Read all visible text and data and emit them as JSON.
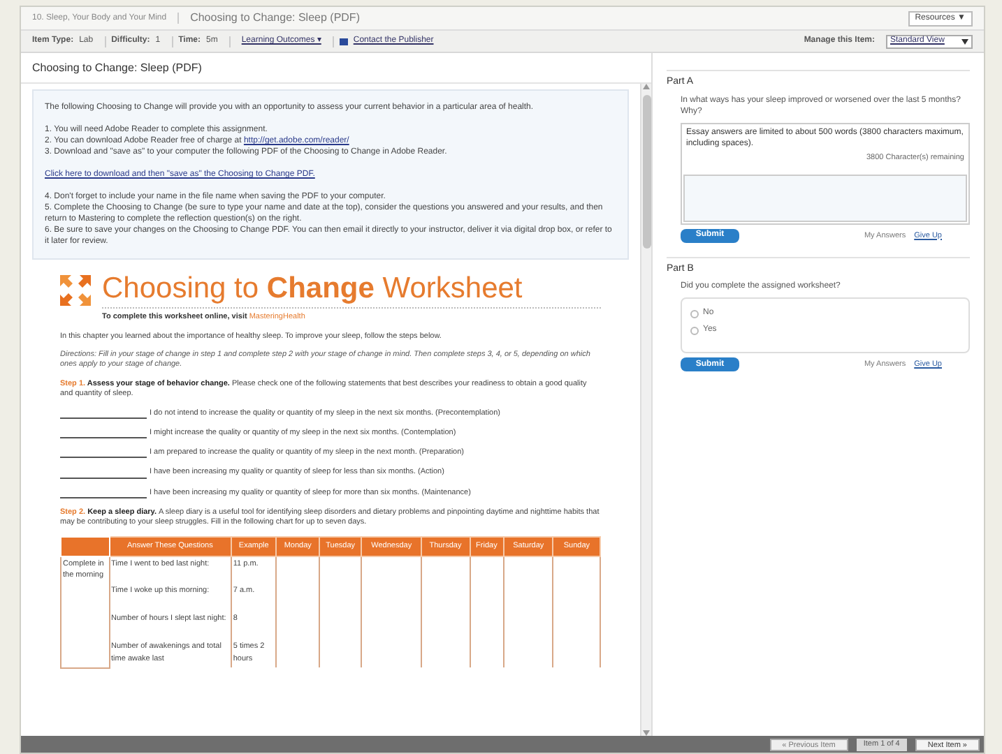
{
  "breadcrumb": {
    "course": "10. Sleep, Your Body and Your Mind",
    "item": "Choosing to Change: Sleep (PDF)",
    "resources": "Resources ▼"
  },
  "info_bar": {
    "fields": [
      {
        "label": "Item Type:",
        "value": "Lab"
      },
      {
        "label": "Difficulty:",
        "value": "1"
      },
      {
        "label": "Time:",
        "value": "5m"
      }
    ],
    "learning_outcomes": "Learning Outcomes ▾",
    "contact": "Contact the Publisher",
    "manage_label": "Manage this Item:",
    "manage_view": "Standard View"
  },
  "content": {
    "title": "Choosing to Change: Sleep (PDF)",
    "intro": "The following Choosing to Change will provide you with an opportunity to assess your current behavior in a particular area of health.",
    "steps_a": [
      {
        "text": "1. You will need Adobe Reader to complete this assignment."
      },
      {
        "text": "2. You can download Adobe Reader free of charge at ",
        "link": "http://get.adobe.com/reader/"
      },
      {
        "text": "3. Download and \"save as\" to your computer the following PDF of the Choosing to Change in Adobe Reader."
      }
    ],
    "download_link": "Click here to download and then \"save as\" the Choosing to Change PDF.",
    "steps_b": [
      "4. Don't forget to include your name in the file name when saving the PDF to your computer.",
      "5. Complete the Choosing to Change (be sure to type your name and date at the top), consider the questions you answered and your results, and then return to Mastering to complete the reflection question(s) on the right.",
      "6. Be sure to save your changes on the Choosing to Change PDF. You can then email it directly to your instructor, deliver it via digital drop box, or refer to it later for review."
    ]
  },
  "worksheet": {
    "title": "Choosing to **Change** Worksheet",
    "subtitle": "To complete this worksheet online, visit",
    "subtitle_link": "MasteringHealth",
    "intro": "In this chapter you learned about the importance of healthy sleep. To improve your sleep, follow the steps below.",
    "directions": "Directions: Fill in your stage of change in step 1 and complete step 2 with your stage of change in mind. Then complete steps 3, 4, or 5, depending on which ones apply to your stage of change.",
    "step1": {
      "label": "Step 1.",
      "heading": "Assess your stage of behavior change.",
      "text": "Please check one of the following statements that best describes your readiness to obtain a good quality and quantity of sleep."
    },
    "statements": [
      "I do not intend to increase the quality or quantity of my sleep in the next six months. (Precontemplation)",
      "I might increase the quality or quantity of my sleep in the next six months. (Contemplation)",
      "I am prepared to increase the quality or quantity of my sleep in the next month. (Preparation)",
      "I have been increasing my quality or quantity of sleep for less than six months. (Action)",
      "I have been increasing my quality or quantity of sleep for more than six months. (Maintenance)"
    ],
    "step2": {
      "label": "Step 2.",
      "heading": "Keep a sleep diary.",
      "text": "A sleep diary is a useful tool for identifying sleep disorders and dietary problems and pinpointing daytime and nighttime habits that may be contributing to your sleep struggles. Fill in the following chart for up to seven days."
    },
    "table": {
      "columns": [
        "Answer These Questions",
        "Example",
        "Monday",
        "Tuesday",
        "Wednesday",
        "Thursday",
        "Friday",
        "Saturday",
        "Sunday"
      ],
      "group": "Complete in the morning",
      "rows": [
        {
          "question": "Time I went to bed last night:",
          "example": "11 p.m."
        },
        {
          "question": "Time I woke up this morning:",
          "example": "7 a.m."
        },
        {
          "question": "Number of hours I slept last night:",
          "example": "8"
        },
        {
          "question": "Number of awakenings and total time awake last",
          "example": "5 times 2 hours"
        }
      ]
    }
  },
  "parts": [
    {
      "title": "Part A",
      "kind": "essay",
      "question": "In what ways has your sleep improved or worsened over the last 5 months? Why?",
      "limit_note": "Essay answers are limited to about 500 words (3800 characters maximum, including spaces).",
      "remaining": "3800 Character(s) remaining",
      "submit": "Submit",
      "my_answers": "My Answers",
      "give_up": "Give Up"
    },
    {
      "title": "Part B",
      "kind": "choice",
      "question": "Did you complete the assigned worksheet?",
      "options": [
        {
          "label": "No",
          "selected": false
        },
        {
          "label": "Yes",
          "selected": false
        }
      ],
      "submit": "Submit",
      "my_answers": "My Answers",
      "give_up": "Give Up"
    }
  ],
  "footer": {
    "previous": "« Previous Item",
    "position": "Item 1 of 4",
    "next": "Next Item »"
  }
}
